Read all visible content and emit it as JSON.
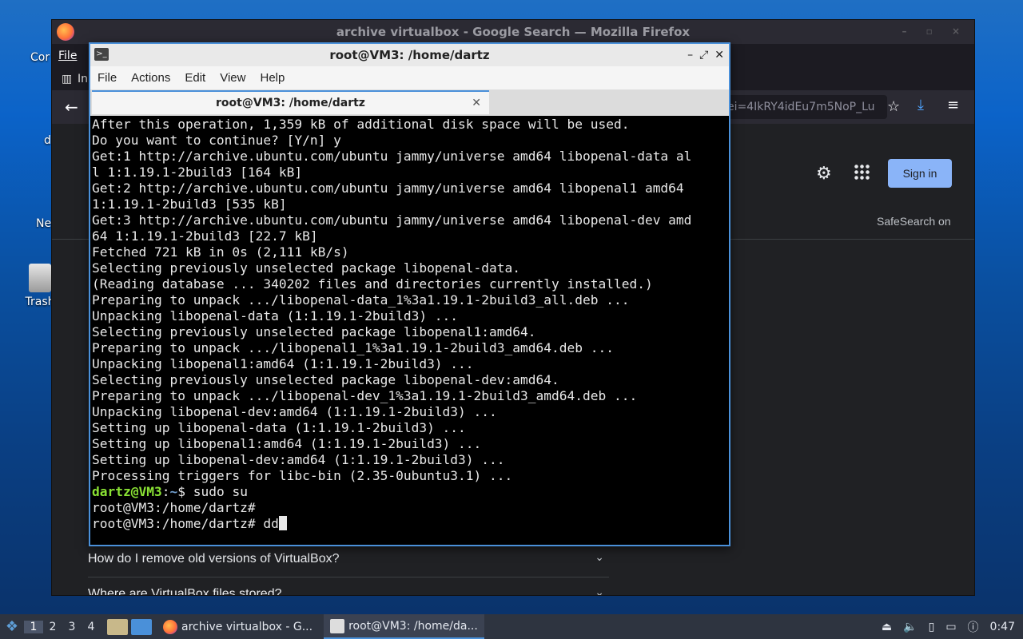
{
  "desktop": {
    "icons": [
      {
        "name": "computer",
        "label": "Cor"
      },
      {
        "name": "home",
        "label": "d"
      },
      {
        "name": "network",
        "label": "Ne"
      },
      {
        "name": "trash",
        "label": "Trash"
      }
    ]
  },
  "firefox": {
    "title": "archive virtualbox - Google Search — Mozilla Firefox",
    "menu_file": "File",
    "tab_label": "In",
    "url_fragment": "ei=4IkRY4idEu7m5NoP_Lu",
    "sign_in": "Sign in",
    "safesearch": "SafeSearch on",
    "faqs": [
      "How do I remove old versions of VirtualBox?",
      "Where are VirtualBox files stored?"
    ]
  },
  "terminal": {
    "title": "root@VM3: /home/dartz",
    "menu": [
      "File",
      "Actions",
      "Edit",
      "View",
      "Help"
    ],
    "tab_title": "root@VM3: /home/dartz",
    "lines": [
      "After this operation, 1,359 kB of additional disk space will be used.",
      "Do you want to continue? [Y/n] y",
      "Get:1 http://archive.ubuntu.com/ubuntu jammy/universe amd64 libopenal-data al",
      "l 1:1.19.1-2build3 [164 kB]",
      "Get:2 http://archive.ubuntu.com/ubuntu jammy/universe amd64 libopenal1 amd64",
      "1:1.19.1-2build3 [535 kB]",
      "Get:3 http://archive.ubuntu.com/ubuntu jammy/universe amd64 libopenal-dev amd",
      "64 1:1.19.1-2build3 [22.7 kB]",
      "Fetched 721 kB in 0s (2,111 kB/s)",
      "Selecting previously unselected package libopenal-data.",
      "(Reading database ... 340202 files and directories currently installed.)",
      "Preparing to unpack .../libopenal-data_1%3a1.19.1-2build3_all.deb ...",
      "Unpacking libopenal-data (1:1.19.1-2build3) ...",
      "Selecting previously unselected package libopenal1:amd64.",
      "Preparing to unpack .../libopenal1_1%3a1.19.1-2build3_amd64.deb ...",
      "Unpacking libopenal1:amd64 (1:1.19.1-2build3) ...",
      "Selecting previously unselected package libopenal-dev:amd64.",
      "Preparing to unpack .../libopenal-dev_1%3a1.19.1-2build3_amd64.deb ...",
      "Unpacking libopenal-dev:amd64 (1:1.19.1-2build3) ...",
      "Setting up libopenal-data (1:1.19.1-2build3) ...",
      "Setting up libopenal1:amd64 (1:1.19.1-2build3) ...",
      "Setting up libopenal-dev:amd64 (1:1.19.1-2build3) ...",
      "Processing triggers for libc-bin (2.35-0ubuntu3.1) ..."
    ],
    "prompt_user": "dartz@VM3",
    "prompt_sep": ":",
    "prompt_path": "~",
    "prompt_end": "$ ",
    "cmd1": "sudo su",
    "root_prompt_1": "root@VM3:/home/dartz#",
    "root_prompt_2": "root@VM3:/home/dartz# ",
    "current_input": "dd"
  },
  "taskbar": {
    "workspaces": [
      "1",
      "2",
      "3",
      "4"
    ],
    "tasks": [
      {
        "name": "firefox",
        "label": "archive virtualbox - G..."
      },
      {
        "name": "terminal",
        "label": "root@VM3: /home/da..."
      }
    ],
    "clock": "0:47"
  },
  "colors": {
    "terminal_accent": "#4a90d9",
    "prompt_user": "#8ae234",
    "prompt_path": "#729fcf",
    "google_signin": "#8ab4f8"
  }
}
